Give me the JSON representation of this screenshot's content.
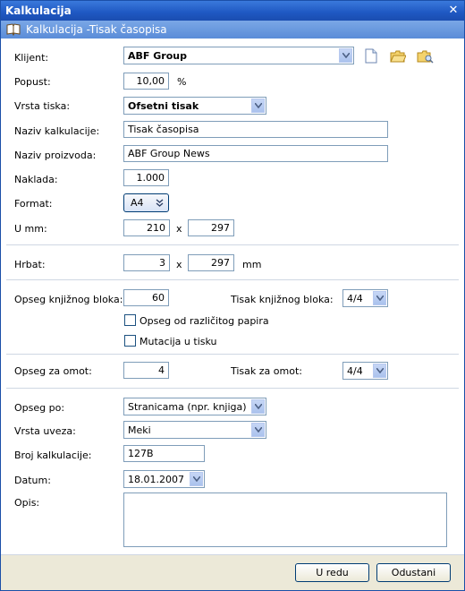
{
  "window": {
    "title": "Kalkulacija",
    "close_glyph": "✕"
  },
  "subheader": {
    "title": "Kalkulacija -Tisak časopisa",
    "icon": "book-icon"
  },
  "fields": {
    "klijent": {
      "label": "Klijent:",
      "value": "ABF Group"
    },
    "popust": {
      "label": "Popust:",
      "value": "10,00",
      "unit": "%"
    },
    "vrsta_tiska": {
      "label": "Vrsta tiska:",
      "value": "Ofsetni tisak"
    },
    "naziv_kalkulacije": {
      "label": "Naziv kalkulacije:",
      "value": "Tisak časopisa"
    },
    "naziv_proizvoda": {
      "label": "Naziv proizvoda:",
      "value": "ABF Group News"
    },
    "naklada": {
      "label": "Naklada:",
      "value": "1.000"
    },
    "format": {
      "label": "Format:",
      "value": "A4"
    },
    "u_mm": {
      "label": "U mm:",
      "width": "210",
      "x": "x",
      "height": "297"
    },
    "hrbat": {
      "label": "Hrbat:",
      "width": "3",
      "x": "x",
      "height": "297",
      "unit": "mm"
    },
    "opseg_knjiznog_bloka": {
      "label": "Opseg knjižnog bloka:",
      "value": "60"
    },
    "tisak_knjiznog_bloka": {
      "label": "Tisak knjižnog bloka:",
      "value": "4/4"
    },
    "opseg_od_razlicitog_papira": {
      "label": "Opseg od različitog papira",
      "checked": false
    },
    "mutacija_u_tisku": {
      "label": "Mutacija u tisku",
      "checked": false
    },
    "opseg_za_omot": {
      "label": "Opseg za omot:",
      "value": "4"
    },
    "tisak_za_omot": {
      "label": "Tisak za omot:",
      "value": "4/4"
    },
    "opseg_po": {
      "label": "Opseg po:",
      "value": "Stranicama (npr. knjiga)"
    },
    "vrsta_uveza": {
      "label": "Vrsta uveza:",
      "value": "Meki"
    },
    "broj_kalkulacije": {
      "label": "Broj kalkulacije:",
      "value": "127B"
    },
    "datum": {
      "label": "Datum:",
      "value": "18.01.2007"
    },
    "opis": {
      "label": "Opis:",
      "value": ""
    }
  },
  "client_actions": [
    "new-document-icon",
    "open-folder-icon",
    "search-folder-icon"
  ],
  "buttons": {
    "ok": "U redu",
    "cancel": "Odustani"
  },
  "colors": {
    "titlebar": "#1f58c2",
    "subheader": "#5a8cd8",
    "border": "#7f9db9"
  }
}
